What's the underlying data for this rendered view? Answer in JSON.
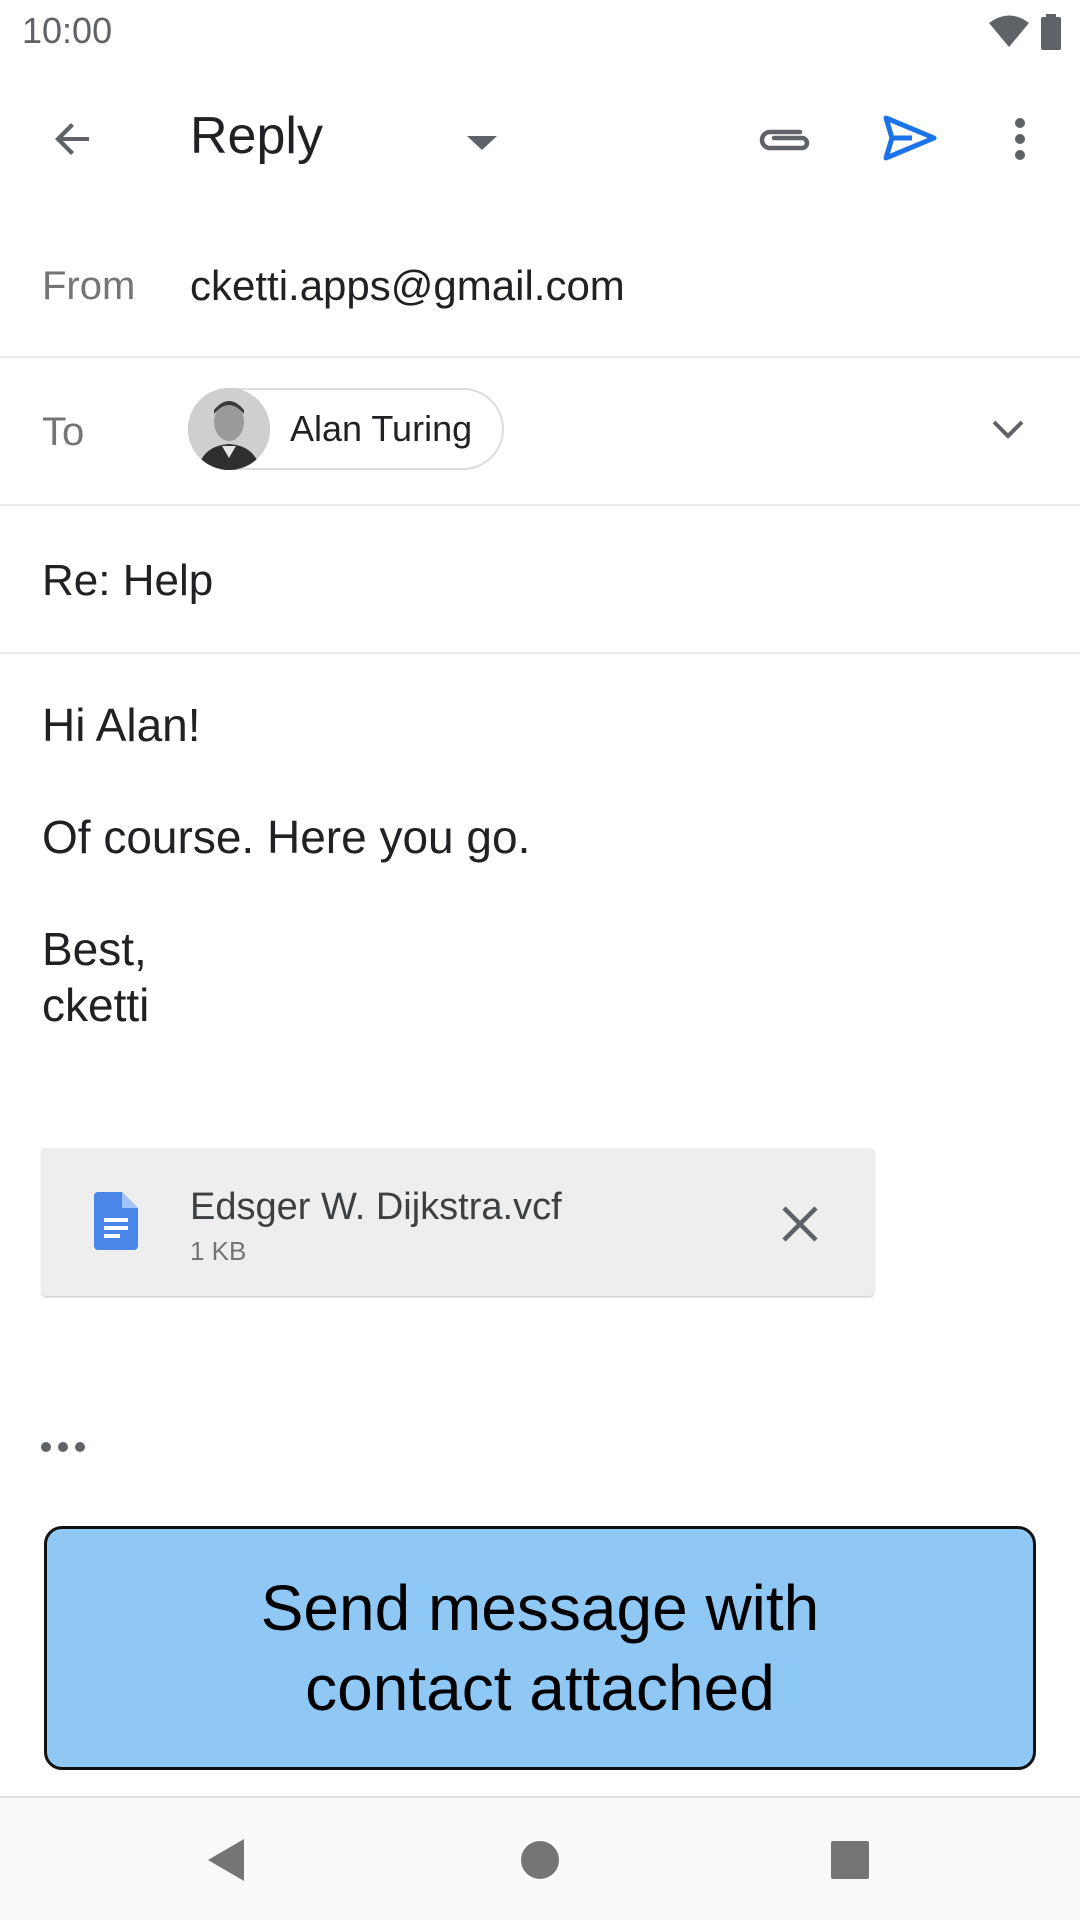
{
  "status_bar": {
    "time": "10:00",
    "icons": [
      "wifi-icon",
      "battery-icon"
    ]
  },
  "app_bar": {
    "title": "Reply",
    "icons": [
      "back-arrow-icon",
      "dropdown-caret-icon",
      "paperclip-icon",
      "send-icon",
      "more-vert-icon"
    ],
    "send_color": "#1a73e8"
  },
  "compose": {
    "from_label": "From",
    "from_value": "cketti.apps@gmail.com",
    "to_label": "To",
    "to_chip_name": "Alan Turing",
    "subject": "Re: Help",
    "body_lines": [
      "Hi Alan!",
      "Of course. Here you go.",
      "Best,",
      "cketti"
    ]
  },
  "attachment": {
    "file_name": "Edsger W. Dijkstra.vcf",
    "file_size": "1 KB",
    "icon": "document-icon",
    "icon_color": "#4a86e8"
  },
  "overlay": {
    "label": "Send message with contact attached",
    "background": "#90c8f5"
  },
  "nav_bar": {
    "icons": [
      "nav-back-icon",
      "nav-home-icon",
      "nav-recents-icon"
    ]
  }
}
